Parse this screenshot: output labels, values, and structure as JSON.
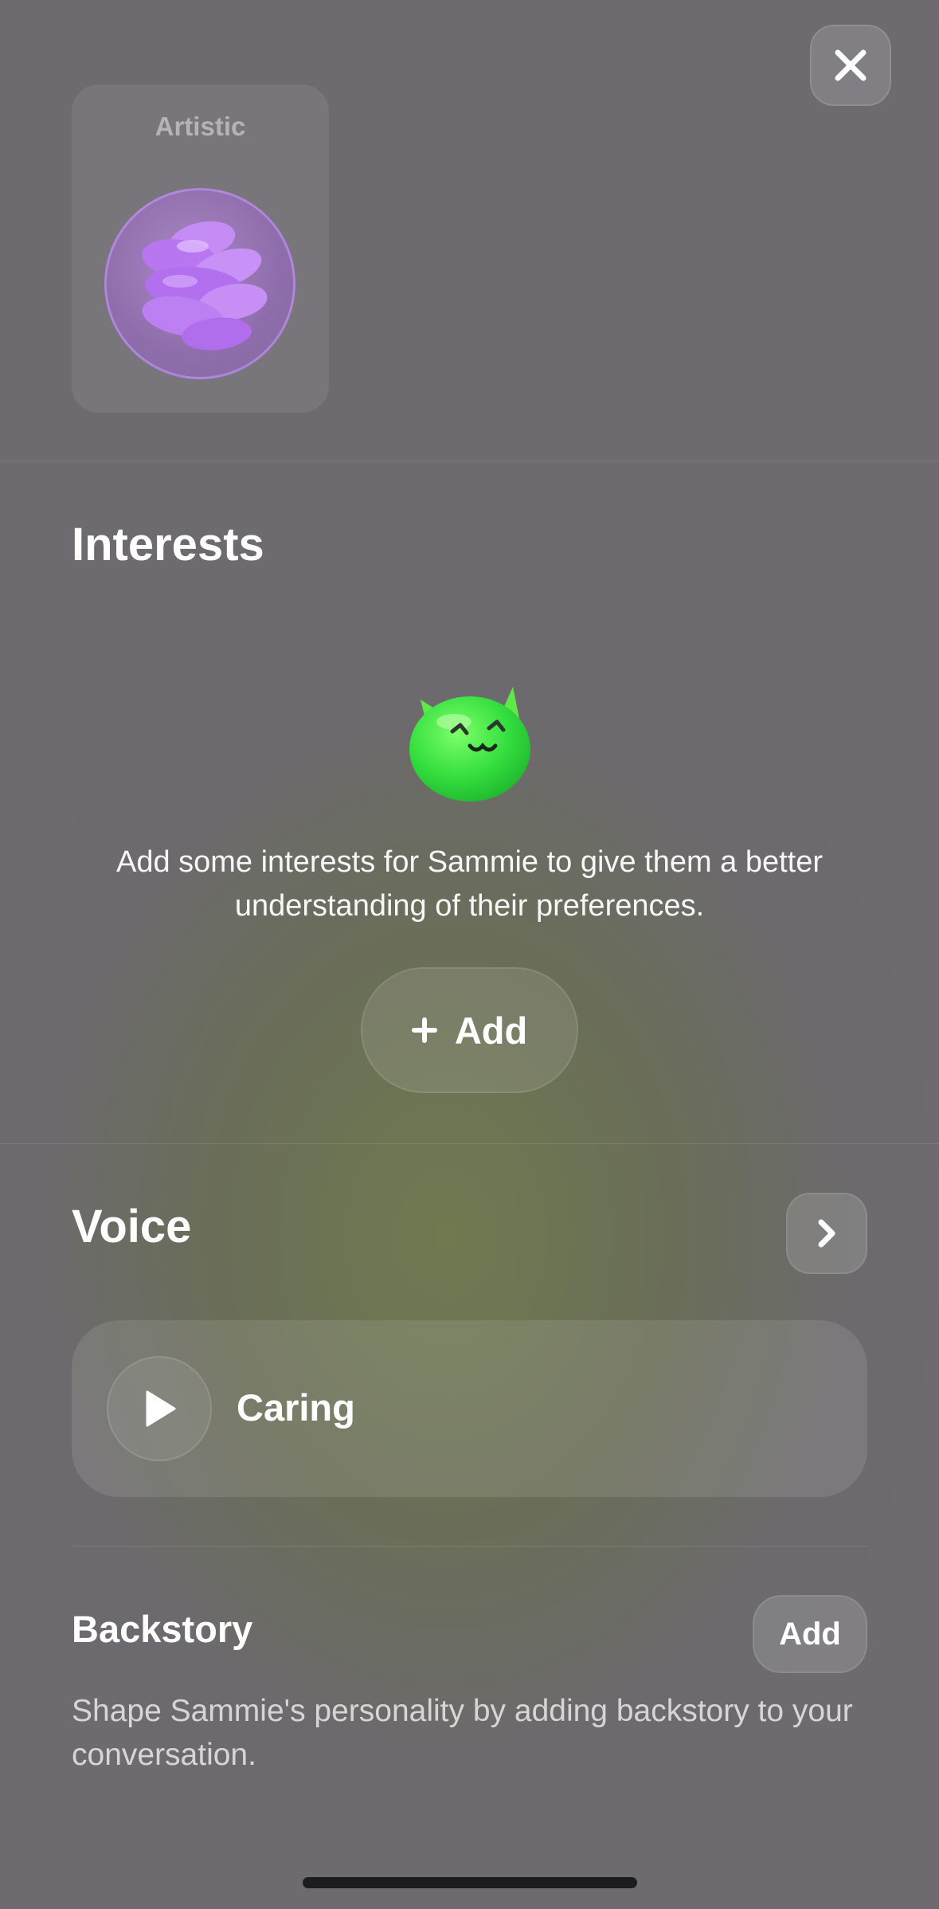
{
  "traits": {
    "card_label": "Artistic"
  },
  "interests": {
    "title": "Interests",
    "description": "Add some interests for Sammie to give them a better understanding of their preferences.",
    "add_label": "Add"
  },
  "voice": {
    "title": "Voice",
    "selected_voice": "Caring"
  },
  "backstory": {
    "title": "Backstory",
    "add_label": "Add",
    "description": "Shape Sammie's personality by adding backstory to your conversation."
  },
  "icons": {
    "close": "close-icon",
    "orb": "purple-orb-icon",
    "mascot": "green-cat-mascot-icon",
    "plus": "plus-icon",
    "chevron": "chevron-right-icon",
    "play": "play-icon"
  },
  "colors": {
    "mascot_green": "#3fe04a",
    "orb_purple": "#c083f5"
  }
}
